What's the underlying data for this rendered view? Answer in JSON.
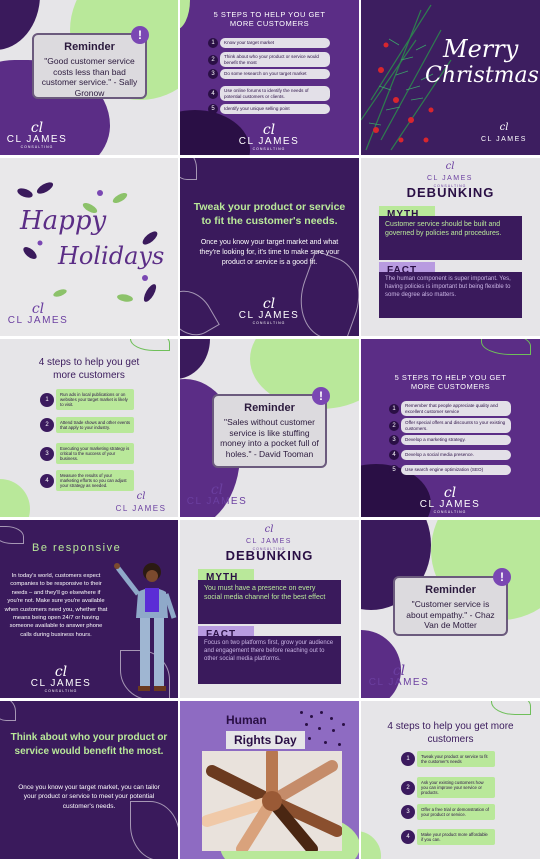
{
  "brand": {
    "monogram": "cl",
    "name": "CL JAMES",
    "sub": "CONSULTING"
  },
  "colors": {
    "purple_dark": "#3a1a5c",
    "purple_mid": "#5b2d86",
    "green": "#b9e89a",
    "light": "#e6e5e8",
    "accent": "#7a47b3"
  },
  "icons": [
    "exclamation-icon",
    "leaf-icon",
    "holly-icon",
    "palm-leaf-icon"
  ],
  "tiles": {
    "t1": {
      "title": "Reminder",
      "quote": "\"Good customer service costs less than bad customer service.\" - Sally Gronow",
      "bang": "!"
    },
    "t2": {
      "title": "5 STEPS TO HELP YOU GET MORE CUSTOMERS",
      "steps": [
        "Know your target market",
        "Think about who your product or service would benefit the most",
        "Do some research on your target market",
        "Use online forums to identify the needs of potential customers or clients.",
        "Identify your unique selling point"
      ]
    },
    "t3": {
      "line1": "Merry",
      "line2": "Christmas"
    },
    "t4": {
      "line1": "Happy",
      "line2": "Holidays"
    },
    "t5": {
      "headline": "Tweak your product or service to fit the customer's needs.",
      "body": "Once you know your target market and what they're looking for, it's time to make sure your product or service is a good fit."
    },
    "t6": {
      "title": "DEBUNKING",
      "myth_label": "MYTH",
      "myth": "Customer service should be built and governed by policies and procedures.",
      "fact_label": "FACT",
      "fact": "The human component is super important. Yes, having policies is important but being flexible to some degree also matters."
    },
    "t7": {
      "title": "4 steps to help you get more customers",
      "steps": [
        "Run ads in local publications or on websites your target market is likely to visit.",
        "Attend trade shows and other events that apply to your industry.",
        "Executing your marketing strategy is critical to the success of your business.",
        "Measure the results of your marketing efforts so you can adjust your strategy as needed."
      ]
    },
    "t8": {
      "title": "Reminder",
      "quote": "\"Sales without customer service is like stuffing money into a pocket full of holes.\" - David Tooman",
      "bang": "!"
    },
    "t9": {
      "title": "5 STEPS TO HELP YOU GET MORE CUSTOMERS",
      "steps": [
        "Remember that people appreciate quality and excellent customer service",
        "Offer special offers and discounts to your existing customers.",
        "Develop a marketing strategy.",
        "Develop a social media presence.",
        "Use search engine optimization (SEO)"
      ]
    },
    "t10": {
      "title": "Be responsive",
      "body": "In today's world, customers expect companies to be responsive to their needs – and they'll go elsewhere if you're not. Make sure you're available when customers need you, whether that means being open 24/7 or having someone available to answer phone calls during business hours."
    },
    "t11": {
      "title": "DEBUNKING",
      "myth_label": "MYTH",
      "myth": "You must have a presence on every social media channel for the best effect",
      "fact_label": "FACT",
      "fact": "Focus on two platforms first, grow your audience and engagement there before reaching out to other social media platforms."
    },
    "t12": {
      "title": "Reminder",
      "quote": "\"Customer service is about empathy.\" - Chaz Van de Motter",
      "bang": "!"
    },
    "t13": {
      "headline": "Think about who your product or service would benefit the most.",
      "body": "Once you know your target market, you can tailor your product or service to meet your potential customer's needs."
    },
    "t14": {
      "line1": "Human",
      "line2": "Rights Day"
    },
    "t15": {
      "title": "4 steps to help you get more customers",
      "steps": [
        "Tweak your product or service to fit the customer's needs",
        "Ask your existing customers how you can improve your service or products.",
        "Offer a free trial or demonstration of your product or service.",
        "Make your product more affordable if you can."
      ]
    }
  }
}
